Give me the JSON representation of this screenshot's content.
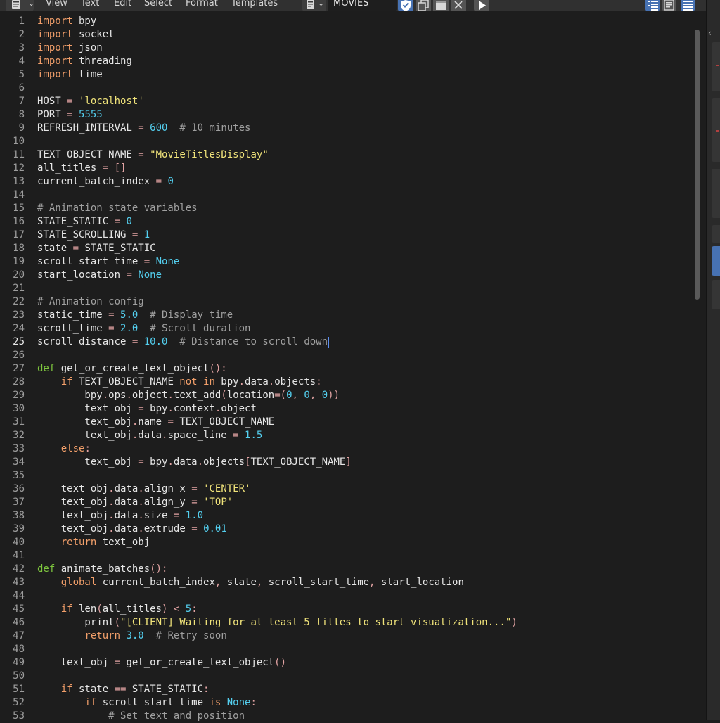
{
  "header": {
    "menu": [
      "View",
      "Text",
      "Edit",
      "Select",
      "Format",
      "Templates"
    ],
    "text_block_name": "MOVIES",
    "icons": {
      "editor_type": "text-editor-icon",
      "text_block_browse": "text-document-icon",
      "fake_user": "shield-check-icon",
      "duplicate": "duplicate-icon",
      "new": "new-text-icon",
      "unlink": "close-icon",
      "run": "play-icon",
      "line_numbers": "line-numbers-icon",
      "word_wrap": "word-wrap-icon",
      "syntax_highlight": "syntax-highlight-icon"
    },
    "colors": {
      "accent": "#4772b3",
      "header_bg": "#303030",
      "editor_bg": "#1d1d1d"
    }
  },
  "editor": {
    "active_line": 25,
    "line_numbers": [
      "1",
      "2",
      "3",
      "4",
      "5",
      "6",
      "7",
      "8",
      "9",
      "10",
      "11",
      "12",
      "13",
      "14",
      "15",
      "16",
      "17",
      "18",
      "19",
      "20",
      "21",
      "22",
      "23",
      "24",
      "25",
      "26",
      "27",
      "28",
      "29",
      "30",
      "31",
      "32",
      "33",
      "34",
      "35",
      "36",
      "37",
      "38",
      "39",
      "40",
      "41",
      "42",
      "43",
      "44",
      "45",
      "46",
      "47",
      "48",
      "49",
      "50",
      "51",
      "52",
      "53"
    ],
    "lines": [
      [
        [
          "k",
          "import"
        ],
        [
          "p",
          " bpy"
        ]
      ],
      [
        [
          "k",
          "import"
        ],
        [
          "p",
          " socket"
        ]
      ],
      [
        [
          "k",
          "import"
        ],
        [
          "p",
          " json"
        ]
      ],
      [
        [
          "k",
          "import"
        ],
        [
          "p",
          " threading"
        ]
      ],
      [
        [
          "k",
          "import"
        ],
        [
          "p",
          " time"
        ]
      ],
      [],
      [
        [
          "p",
          "HOST "
        ],
        [
          "o",
          "="
        ],
        [
          "p",
          " "
        ],
        [
          "s",
          "'localhost'"
        ]
      ],
      [
        [
          "p",
          "PORT "
        ],
        [
          "o",
          "="
        ],
        [
          "p",
          " "
        ],
        [
          "n",
          "5555"
        ]
      ],
      [
        [
          "p",
          "REFRESH_INTERVAL "
        ],
        [
          "o",
          "="
        ],
        [
          "p",
          " "
        ],
        [
          "n",
          "600"
        ],
        [
          "p",
          "  "
        ],
        [
          "c",
          "# 10 minutes"
        ]
      ],
      [],
      [
        [
          "p",
          "TEXT_OBJECT_NAME "
        ],
        [
          "o",
          "="
        ],
        [
          "p",
          " "
        ],
        [
          "s",
          "\"MovieTitlesDisplay\""
        ]
      ],
      [
        [
          "p",
          "all_titles "
        ],
        [
          "o",
          "="
        ],
        [
          "p",
          " "
        ],
        [
          "o",
          "[]"
        ]
      ],
      [
        [
          "p",
          "current_batch_index "
        ],
        [
          "o",
          "="
        ],
        [
          "p",
          " "
        ],
        [
          "n",
          "0"
        ]
      ],
      [],
      [
        [
          "c",
          "# Animation state variables"
        ]
      ],
      [
        [
          "p",
          "STATE_STATIC "
        ],
        [
          "o",
          "="
        ],
        [
          "p",
          " "
        ],
        [
          "n",
          "0"
        ]
      ],
      [
        [
          "p",
          "STATE_SCROLLING "
        ],
        [
          "o",
          "="
        ],
        [
          "p",
          " "
        ],
        [
          "n",
          "1"
        ]
      ],
      [
        [
          "p",
          "state "
        ],
        [
          "o",
          "="
        ],
        [
          "p",
          " STATE_STATIC"
        ]
      ],
      [
        [
          "p",
          "scroll_start_time "
        ],
        [
          "o",
          "="
        ],
        [
          "p",
          " "
        ],
        [
          "n",
          "None"
        ]
      ],
      [
        [
          "p",
          "start_location "
        ],
        [
          "o",
          "="
        ],
        [
          "p",
          " "
        ],
        [
          "n",
          "None"
        ]
      ],
      [],
      [
        [
          "c",
          "# Animation config"
        ]
      ],
      [
        [
          "p",
          "static_time "
        ],
        [
          "o",
          "="
        ],
        [
          "p",
          " "
        ],
        [
          "n",
          "5.0"
        ],
        [
          "p",
          "  "
        ],
        [
          "c",
          "# Display time"
        ]
      ],
      [
        [
          "p",
          "scroll_time "
        ],
        [
          "o",
          "="
        ],
        [
          "p",
          " "
        ],
        [
          "n",
          "2.0"
        ],
        [
          "p",
          "  "
        ],
        [
          "c",
          "# Scroll duration"
        ]
      ],
      [
        [
          "p",
          "scroll_distance "
        ],
        [
          "o",
          "="
        ],
        [
          "p",
          " "
        ],
        [
          "n",
          "10.0"
        ],
        [
          "p",
          "  "
        ],
        [
          "c",
          "# Distance to scroll down"
        ]
      ],
      [],
      [
        [
          "x",
          "def"
        ],
        [
          "p",
          " get_or_create_text_object"
        ],
        [
          "o",
          "():"
        ]
      ],
      [
        [
          "p",
          "    "
        ],
        [
          "k",
          "if"
        ],
        [
          "p",
          " TEXT_OBJECT_NAME "
        ],
        [
          "k",
          "not in"
        ],
        [
          "p",
          " bpy"
        ],
        [
          "o",
          "."
        ],
        [
          "p",
          "data"
        ],
        [
          "o",
          "."
        ],
        [
          "p",
          "objects"
        ],
        [
          "o",
          ":"
        ]
      ],
      [
        [
          "p",
          "        bpy"
        ],
        [
          "o",
          "."
        ],
        [
          "p",
          "ops"
        ],
        [
          "o",
          "."
        ],
        [
          "p",
          "object"
        ],
        [
          "o",
          "."
        ],
        [
          "p",
          "text_add"
        ],
        [
          "o",
          "("
        ],
        [
          "p",
          "location"
        ],
        [
          "o",
          "=("
        ],
        [
          "n",
          "0"
        ],
        [
          "o",
          ","
        ],
        [
          "p",
          " "
        ],
        [
          "n",
          "0"
        ],
        [
          "o",
          ","
        ],
        [
          "p",
          " "
        ],
        [
          "n",
          "0"
        ],
        [
          "o",
          "))"
        ]
      ],
      [
        [
          "p",
          "        text_obj "
        ],
        [
          "o",
          "="
        ],
        [
          "p",
          " bpy"
        ],
        [
          "o",
          "."
        ],
        [
          "p",
          "context"
        ],
        [
          "o",
          "."
        ],
        [
          "p",
          "object"
        ]
      ],
      [
        [
          "p",
          "        text_obj"
        ],
        [
          "o",
          "."
        ],
        [
          "p",
          "name "
        ],
        [
          "o",
          "="
        ],
        [
          "p",
          " TEXT_OBJECT_NAME"
        ]
      ],
      [
        [
          "p",
          "        text_obj"
        ],
        [
          "o",
          "."
        ],
        [
          "p",
          "data"
        ],
        [
          "o",
          "."
        ],
        [
          "p",
          "space_line "
        ],
        [
          "o",
          "="
        ],
        [
          "p",
          " "
        ],
        [
          "n",
          "1.5"
        ]
      ],
      [
        [
          "p",
          "    "
        ],
        [
          "k",
          "else"
        ],
        [
          "o",
          ":"
        ]
      ],
      [
        [
          "p",
          "        text_obj "
        ],
        [
          "o",
          "="
        ],
        [
          "p",
          " bpy"
        ],
        [
          "o",
          "."
        ],
        [
          "p",
          "data"
        ],
        [
          "o",
          "."
        ],
        [
          "p",
          "objects"
        ],
        [
          "o",
          "["
        ],
        [
          "p",
          "TEXT_OBJECT_NAME"
        ],
        [
          "o",
          "]"
        ]
      ],
      [],
      [
        [
          "p",
          "    text_obj"
        ],
        [
          "o",
          "."
        ],
        [
          "p",
          "data"
        ],
        [
          "o",
          "."
        ],
        [
          "p",
          "align_x "
        ],
        [
          "o",
          "="
        ],
        [
          "p",
          " "
        ],
        [
          "s",
          "'CENTER'"
        ]
      ],
      [
        [
          "p",
          "    text_obj"
        ],
        [
          "o",
          "."
        ],
        [
          "p",
          "data"
        ],
        [
          "o",
          "."
        ],
        [
          "p",
          "align_y "
        ],
        [
          "o",
          "="
        ],
        [
          "p",
          " "
        ],
        [
          "s",
          "'TOP'"
        ]
      ],
      [
        [
          "p",
          "    text_obj"
        ],
        [
          "o",
          "."
        ],
        [
          "p",
          "data"
        ],
        [
          "o",
          "."
        ],
        [
          "p",
          "size "
        ],
        [
          "o",
          "="
        ],
        [
          "p",
          " "
        ],
        [
          "n",
          "1.0"
        ]
      ],
      [
        [
          "p",
          "    text_obj"
        ],
        [
          "o",
          "."
        ],
        [
          "p",
          "data"
        ],
        [
          "o",
          "."
        ],
        [
          "p",
          "extrude "
        ],
        [
          "o",
          "="
        ],
        [
          "p",
          " "
        ],
        [
          "n",
          "0.01"
        ]
      ],
      [
        [
          "p",
          "    "
        ],
        [
          "k",
          "return"
        ],
        [
          "p",
          " text_obj"
        ]
      ],
      [],
      [
        [
          "x",
          "def"
        ],
        [
          "p",
          " animate_batches"
        ],
        [
          "o",
          "():"
        ]
      ],
      [
        [
          "p",
          "    "
        ],
        [
          "k",
          "global"
        ],
        [
          "p",
          " current_batch_index"
        ],
        [
          "o",
          ","
        ],
        [
          "p",
          " state"
        ],
        [
          "o",
          ","
        ],
        [
          "p",
          " scroll_start_time"
        ],
        [
          "o",
          ","
        ],
        [
          "p",
          " start_location"
        ]
      ],
      [],
      [
        [
          "p",
          "    "
        ],
        [
          "k",
          "if"
        ],
        [
          "p",
          " len"
        ],
        [
          "o",
          "("
        ],
        [
          "p",
          "all_titles"
        ],
        [
          "o",
          ")"
        ],
        [
          "p",
          " "
        ],
        [
          "o",
          "<"
        ],
        [
          "p",
          " "
        ],
        [
          "n",
          "5"
        ],
        [
          "o",
          ":"
        ]
      ],
      [
        [
          "p",
          "        print"
        ],
        [
          "o",
          "("
        ],
        [
          "s",
          "\"[CLIENT] Waiting for at least 5 titles to start visualization...\""
        ],
        [
          "o",
          ")"
        ]
      ],
      [
        [
          "p",
          "        "
        ],
        [
          "k",
          "return"
        ],
        [
          "p",
          " "
        ],
        [
          "n",
          "3.0"
        ],
        [
          "p",
          "  "
        ],
        [
          "c",
          "# Retry soon"
        ]
      ],
      [],
      [
        [
          "p",
          "    text_obj "
        ],
        [
          "o",
          "="
        ],
        [
          "p",
          " get_or_create_text_object"
        ],
        [
          "o",
          "()"
        ]
      ],
      [],
      [
        [
          "p",
          "    "
        ],
        [
          "k",
          "if"
        ],
        [
          "p",
          " state "
        ],
        [
          "o",
          "=="
        ],
        [
          "p",
          " STATE_STATIC"
        ],
        [
          "o",
          ":"
        ]
      ],
      [
        [
          "p",
          "        "
        ],
        [
          "k",
          "if"
        ],
        [
          "p",
          " scroll_start_time "
        ],
        [
          "k",
          "is"
        ],
        [
          "p",
          " "
        ],
        [
          "n",
          "None"
        ],
        [
          "o",
          ":"
        ]
      ],
      [
        [
          "p",
          "            "
        ],
        [
          "c",
          "# Set text and position"
        ]
      ]
    ]
  }
}
